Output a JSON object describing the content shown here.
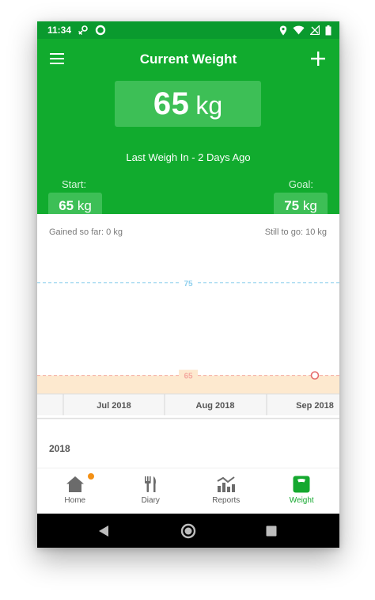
{
  "status_bar": {
    "time": "11:34"
  },
  "header": {
    "title": "Current Weight",
    "current_weight": {
      "value": "65",
      "unit": "kg"
    },
    "last_weigh_in": "Last Weigh In - 2 Days Ago",
    "start": {
      "label": "Start:",
      "value": "65",
      "unit": "kg"
    },
    "goal": {
      "label": "Goal:",
      "value": "75",
      "unit": "kg"
    }
  },
  "progress": {
    "gained_so_far": "Gained so far: 0 kg",
    "still_to_go": "Still to go: 10 kg"
  },
  "chart_data": {
    "type": "line",
    "x_tick_labels": [
      "Jul 2018",
      "Aug 2018",
      "Sep 2018"
    ],
    "reference_lines": [
      {
        "value": 75,
        "label": "75",
        "color": "#8fd0ee"
      },
      {
        "value": 65,
        "label": "65",
        "color": "#f4a9a0"
      }
    ],
    "points": [
      {
        "x": "Sep 2018",
        "y": 65
      }
    ],
    "ylim": [
      63,
      79
    ],
    "goal_band_color": "#fde9cf",
    "point_color": "#e56d6d"
  },
  "history": {
    "year": "2018"
  },
  "bottom_nav": {
    "items": [
      {
        "label": "Home",
        "icon": "home-icon"
      },
      {
        "label": "Diary",
        "icon": "fork-knife-icon"
      },
      {
        "label": "Reports",
        "icon": "bar-chart-icon"
      },
      {
        "label": "Weight",
        "icon": "scale-icon"
      }
    ],
    "active": "Weight"
  },
  "colors": {
    "primary": "#11ab2e",
    "primary_dark": "#0a9a2e",
    "box": "#3dbf56",
    "notification": "#f39015"
  }
}
